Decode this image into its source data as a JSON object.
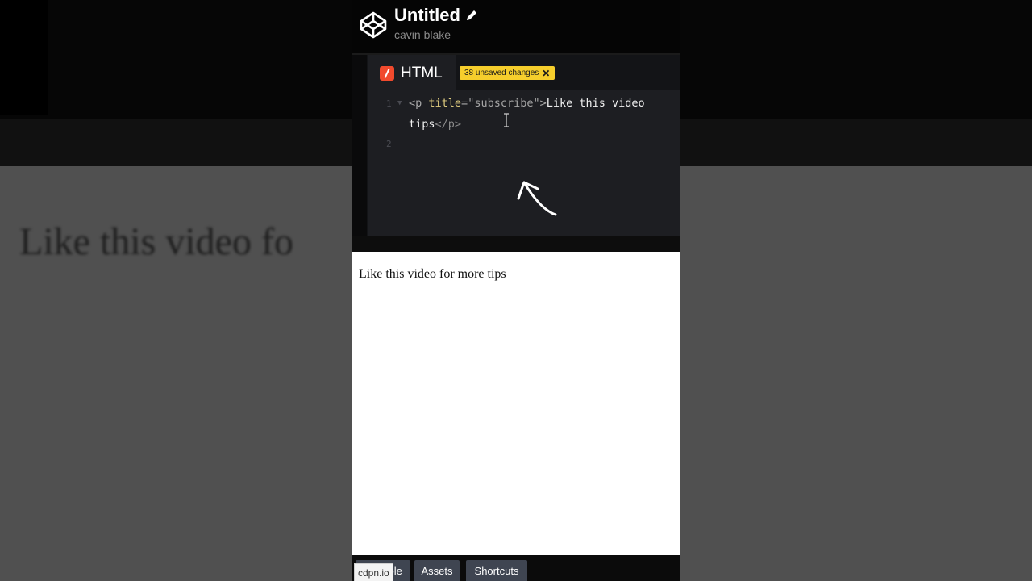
{
  "background_text": "Like this video fo",
  "pen": {
    "title": "Untitled",
    "owner": "cavin blake"
  },
  "editor": {
    "tab_label": "HTML",
    "unsaved_badge": "38 unsaved changes",
    "line_numbers": [
      "1",
      "2"
    ],
    "code": {
      "open_tag": "<p",
      "attr": " title",
      "eq": "=",
      "attr_value": "\"subscribe\"",
      "gt": ">",
      "text_line1": "Like this video",
      "text_line2": "tips",
      "close_tag": "</p>"
    }
  },
  "preview": {
    "text": "Like this video for more tips"
  },
  "footer": {
    "console_label": "Console",
    "assets_label": "Assets",
    "shortcuts_label": "Shortcuts",
    "url_tooltip": "cdpn.io"
  },
  "colors": {
    "accent_badge": "#f6ce2c",
    "html_icon": "#f14a2d",
    "editor_bg": "#1d1e22"
  }
}
